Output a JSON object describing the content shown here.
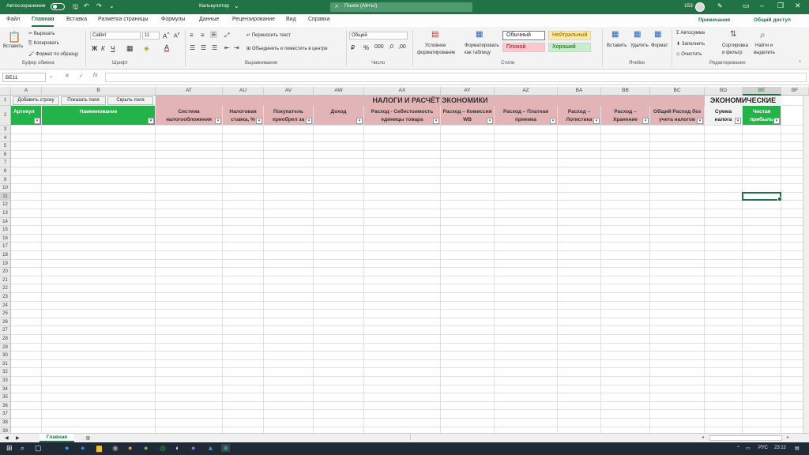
{
  "titlebar": {
    "autosave_label": "Автосохранение",
    "filename": "Калькулятор",
    "search_placeholder": "Поиск (Alt+Ы)",
    "count": "153"
  },
  "tabs": [
    "Файл",
    "Главная",
    "Вставка",
    "Разметка страницы",
    "Формулы",
    "Данные",
    "Рецензирование",
    "Вид",
    "Справка"
  ],
  "tab_active": "Главная",
  "ribbon_right": {
    "notes": "Примечания",
    "share": "Общий доступ"
  },
  "ribbon": {
    "paste": "Вставить",
    "cut": "Вырезать",
    "copy": "Копировать",
    "format_painter": "Формат по образцу",
    "clipboard_group": "Буфер обмена",
    "font_name": "Calibri",
    "font_size": "11",
    "font_group": "Шрифт",
    "wrap_text": "Переносить текст",
    "merge_center": "Объединить и поместить в центре",
    "alignment_group": "Выравнивание",
    "number_format": "Общий",
    "number_group": "Число",
    "cond_format_1": "Условное",
    "cond_format_2": "форматирование",
    "format_table_1": "Форматировать",
    "format_table_2": "как таблицу",
    "styles": {
      "normal": "Обычный",
      "neutral": "Нейтральный",
      "bad": "Плохой",
      "good": "Хороший"
    },
    "styles_group": "Стили",
    "insert": "Вставить",
    "delete": "Удалить",
    "format": "Формат",
    "cells_group": "Ячейки",
    "autosum": "Автосумма",
    "fill": "Заполнить",
    "clear": "Очистить",
    "sort_1": "Сортировка",
    "sort_2": "и фильтр",
    "find_1": "Найти и",
    "find_2": "выделить",
    "editing_group": "Редактирование"
  },
  "formula_bar": {
    "name_box": "BE11",
    "fx": "fx"
  },
  "columns": [
    "A",
    "B",
    "AT",
    "AU",
    "AV",
    "AW",
    "AX",
    "AY",
    "AZ",
    "BA",
    "BB",
    "BC",
    "BD",
    "BE",
    "BF"
  ],
  "selected_column": "BE",
  "rows": [
    "1",
    "2",
    "3",
    "4",
    "5",
    "6",
    "7",
    "8",
    "9",
    "10",
    "11",
    "12",
    "13",
    "14",
    "15",
    "16",
    "17",
    "18",
    "19",
    "20",
    "21",
    "22",
    "23",
    "24",
    "25",
    "26",
    "27",
    "28",
    "29",
    "30",
    "31",
    "32",
    "33",
    "34",
    "35",
    "36",
    "37",
    "38",
    "39"
  ],
  "selected_row": "11",
  "sheet": {
    "buttons": [
      "Добавить строку",
      "Показать поля",
      "Скрыть поля"
    ],
    "title_taxes": "НАЛОГИ И РАСЧЁТ ЭКОНОМИКИ",
    "title_econ": "ЭКОНОМИЧЕСКИЕ",
    "headers": {
      "A": "Артикул",
      "B": "Наименование",
      "AT": [
        "Система",
        "налогообложения"
      ],
      "AU": [
        "Налоговая",
        "ставка, %"
      ],
      "AV": [
        "Покупатель",
        "приобрел за"
      ],
      "AW": [
        "Доход",
        ""
      ],
      "AX": [
        "Расход - Себестоимость",
        "единицы товара"
      ],
      "AY": [
        "Расход – Комиссия",
        "WB"
      ],
      "AZ": [
        "Расход – Платная",
        "приемка"
      ],
      "BA": [
        "Расход –",
        "Логистика"
      ],
      "BB": [
        "Расход –",
        "Хранение"
      ],
      "BC": [
        "Общий Расход без",
        "учета налогов"
      ],
      "BD": [
        "Сумма",
        "налога"
      ],
      "BE": [
        "Чистая",
        "прибыль"
      ]
    }
  },
  "sheet_tab": "Главная",
  "taskbar": {
    "lang": "РУС",
    "time": "23:12"
  },
  "colors": {
    "accent": "#217346",
    "green_header": "#24b34a",
    "pink_header": "#e3b4b6"
  }
}
